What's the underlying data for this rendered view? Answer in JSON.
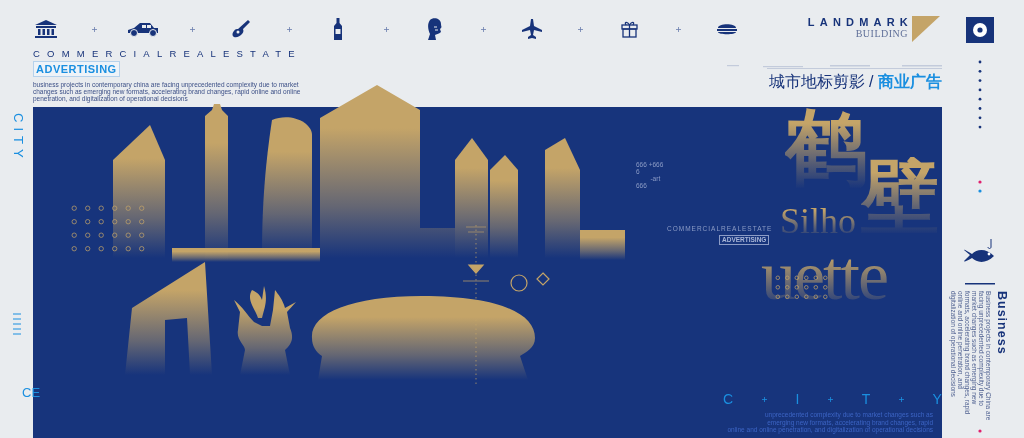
{
  "brand": {
    "title": "LANDMARK",
    "subtitle": "BUILDING"
  },
  "intro": {
    "heading": "COMMERCIALREALESTATE",
    "badge": "ADVERTISING",
    "body": "business projects in contemporary china are facing unprecedented complexity due to market changes such as  emerging new formats, accelerating brand changes, rapid online and online penetration, and digitalization of operational decisions"
  },
  "tagline": "城市地标剪影 / **商业广告**",
  "poster": {
    "side_label": "CITY",
    "codes": "666 +666\n6\n        -art\n666",
    "title_cn": [
      "鹤",
      "壁"
    ],
    "title_en": [
      "Silho",
      "uette"
    ],
    "small_heading": "COMMERCIALREALESTATE",
    "small_badge": "ADVERTISING",
    "footer_letters": [
      "C",
      "I",
      "T",
      "Y"
    ],
    "corner_label": "CE",
    "footnote": "unprecedented complexity due to market changes such as\nemerging new formats, accelerating brand changes, rapid\nonline and online penetration, and digitalization of operational decisions"
  },
  "sidebar": {
    "heading": "Business",
    "body": "Business projects in contemporary China are facing unprecedented complexity due to market changes such as emerging new formats, accelerating brand changes, rapid online and online penetration, and digitalization of operational decisions"
  }
}
